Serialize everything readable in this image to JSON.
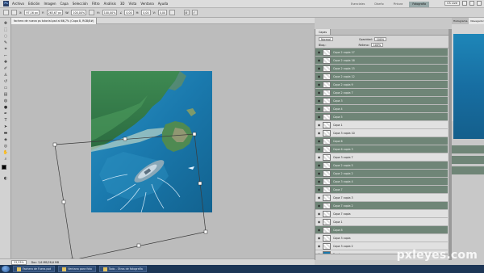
{
  "menubar": {
    "items": [
      "Archivo",
      "Edición",
      "Imagen",
      "Capa",
      "Selección",
      "Filtro",
      "Análisis",
      "3D",
      "Vista",
      "Ventana",
      "Ayuda"
    ],
    "workspaces": [
      "Esenciales",
      "Diseño",
      "Pintura",
      "Fotografía"
    ],
    "active_workspace": "Fotografía",
    "cs_live": "CS Live"
  },
  "options_bar": {
    "x_value": "97,16 px",
    "y_value": "263,67 px",
    "w_value": "100,00%",
    "h_value": "100,00%",
    "angle_value": "0,00",
    "h_skew": "0,00",
    "v_skew": "0,00"
  },
  "document": {
    "tab_title": "fachero de nuevo ps tutorial.psd al 66,7% (Capa 8, RGB/8#)"
  },
  "status_bar": {
    "zoom": "33,33%",
    "doc_info": "Doc: 3,6 MB/28,6 MB"
  },
  "layers_panel": {
    "tabs": [
      "Capas"
    ],
    "blend_mode": "Normal",
    "opacity_label": "Opacidad:",
    "opacity_value": "100%",
    "fill_label": "Relleno:",
    "fill_value": "100%",
    "lock_label": "Bloq.:",
    "layers": [
      {
        "name": "Capa 2 copia 17",
        "selected": true
      },
      {
        "name": "Capa 2 copia 16",
        "selected": true
      },
      {
        "name": "Capa 2 copia 15",
        "selected": true
      },
      {
        "name": "Capa 2 copia 12",
        "selected": true
      },
      {
        "name": "Capa 2 copia 9",
        "selected": true
      },
      {
        "name": "Capa 2 copia 7",
        "selected": true
      },
      {
        "name": "Capa 3",
        "selected": true
      },
      {
        "name": "Capa 4",
        "selected": true
      },
      {
        "name": "Capa 5",
        "selected": true
      },
      {
        "name": "Capa 1",
        "selected": false
      },
      {
        "name": "Capa 3 copia 10",
        "selected": false
      },
      {
        "name": "Capa 6",
        "selected": true
      },
      {
        "name": "Capa 6 copia 3",
        "selected": true
      },
      {
        "name": "Capa 3 copia 7",
        "selected": false
      },
      {
        "name": "Capa 2 copia 5",
        "selected": true
      },
      {
        "name": "Capa 2 copia 2",
        "selected": true
      },
      {
        "name": "Capa 3 copia 4",
        "selected": true
      },
      {
        "name": "Capa 7",
        "selected": true
      },
      {
        "name": "Capa 7 copia 3",
        "selected": false
      },
      {
        "name": "Capa 7 copia 2",
        "selected": true
      },
      {
        "name": "Capa 7 copia",
        "selected": false
      },
      {
        "name": "Capa 1",
        "selected": false
      },
      {
        "name": "Capa 8",
        "selected": true
      },
      {
        "name": "Capa 3 copia",
        "selected": false
      },
      {
        "name": "Capa 3 copia 2",
        "selected": false
      },
      {
        "name": "Fondo",
        "selected": false
      }
    ]
  },
  "navigator": {
    "tabs": [
      "Histograma",
      "Navegador",
      "Información"
    ],
    "active_tab": "Navegador"
  },
  "taskbar": {
    "tasks": [
      "Sin título - Paint",
      "Fachero de Fuera.psd",
      "Ventana para foto",
      "Todo - Otros de fotografía"
    ]
  },
  "watermark": "pxleyes.com",
  "colors": {
    "selected_layer": "#6f8577",
    "taskbar": "#1d3656",
    "sea": "#1a79ad"
  }
}
